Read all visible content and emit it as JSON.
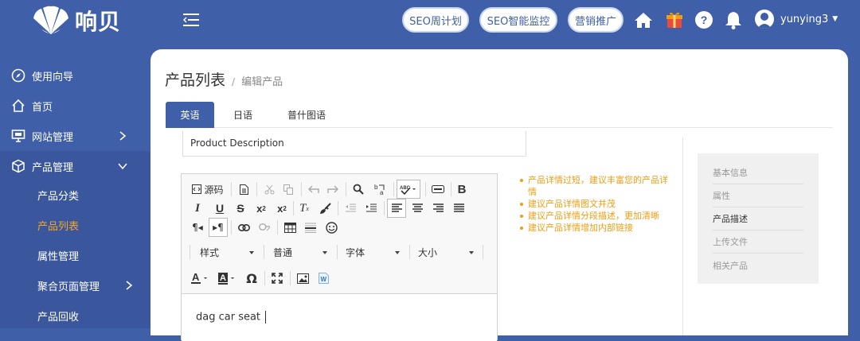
{
  "brand": {
    "name": "响贝"
  },
  "header": {
    "buttons": [
      {
        "label": "SEO周计划"
      },
      {
        "label": "SEO智能监控"
      },
      {
        "label": "营销推广"
      }
    ],
    "icons": [
      "home-icon",
      "gift-icon",
      "help-icon",
      "bell-icon"
    ],
    "user": {
      "name": "yunying3"
    }
  },
  "sidebar": {
    "items": [
      {
        "label": "使用向导",
        "icon": "compass-icon"
      },
      {
        "label": "首页",
        "icon": "home-icon"
      },
      {
        "label": "网站管理",
        "icon": "monitor-icon"
      },
      {
        "label": "产品管理",
        "icon": "box-icon"
      }
    ],
    "subitems": [
      {
        "label": "产品分类"
      },
      {
        "label": "产品列表"
      },
      {
        "label": "属性管理"
      },
      {
        "label": "聚合页面管理"
      },
      {
        "label": "产品回收"
      }
    ]
  },
  "breadcrumb": {
    "title": "产品列表",
    "separator": "/",
    "current": "编辑产品"
  },
  "tabs": [
    {
      "label": "英语"
    },
    {
      "label": "日语"
    },
    {
      "label": "普什图语"
    }
  ],
  "form": {
    "description_label": "Product Description"
  },
  "editor": {
    "source_label": "源码",
    "combos": {
      "style": "样式",
      "format": "普通",
      "font": "字体",
      "size": "大小"
    },
    "content": "dag car seat"
  },
  "tips": [
    "产品详情过短，建议丰富您的产品详情",
    "建议产品详情图文并茂",
    "建议产品详情分段描述，更加清晰",
    "建议产品详情增加内部链接"
  ],
  "right_nav": [
    {
      "label": "基本信息"
    },
    {
      "label": "属性"
    },
    {
      "label": "产品描述"
    },
    {
      "label": "上传文件"
    },
    {
      "label": "相关产品"
    }
  ],
  "colors": {
    "primary": "#3f5fa8",
    "accent": "#f5a623",
    "tip": "#f39c12"
  }
}
